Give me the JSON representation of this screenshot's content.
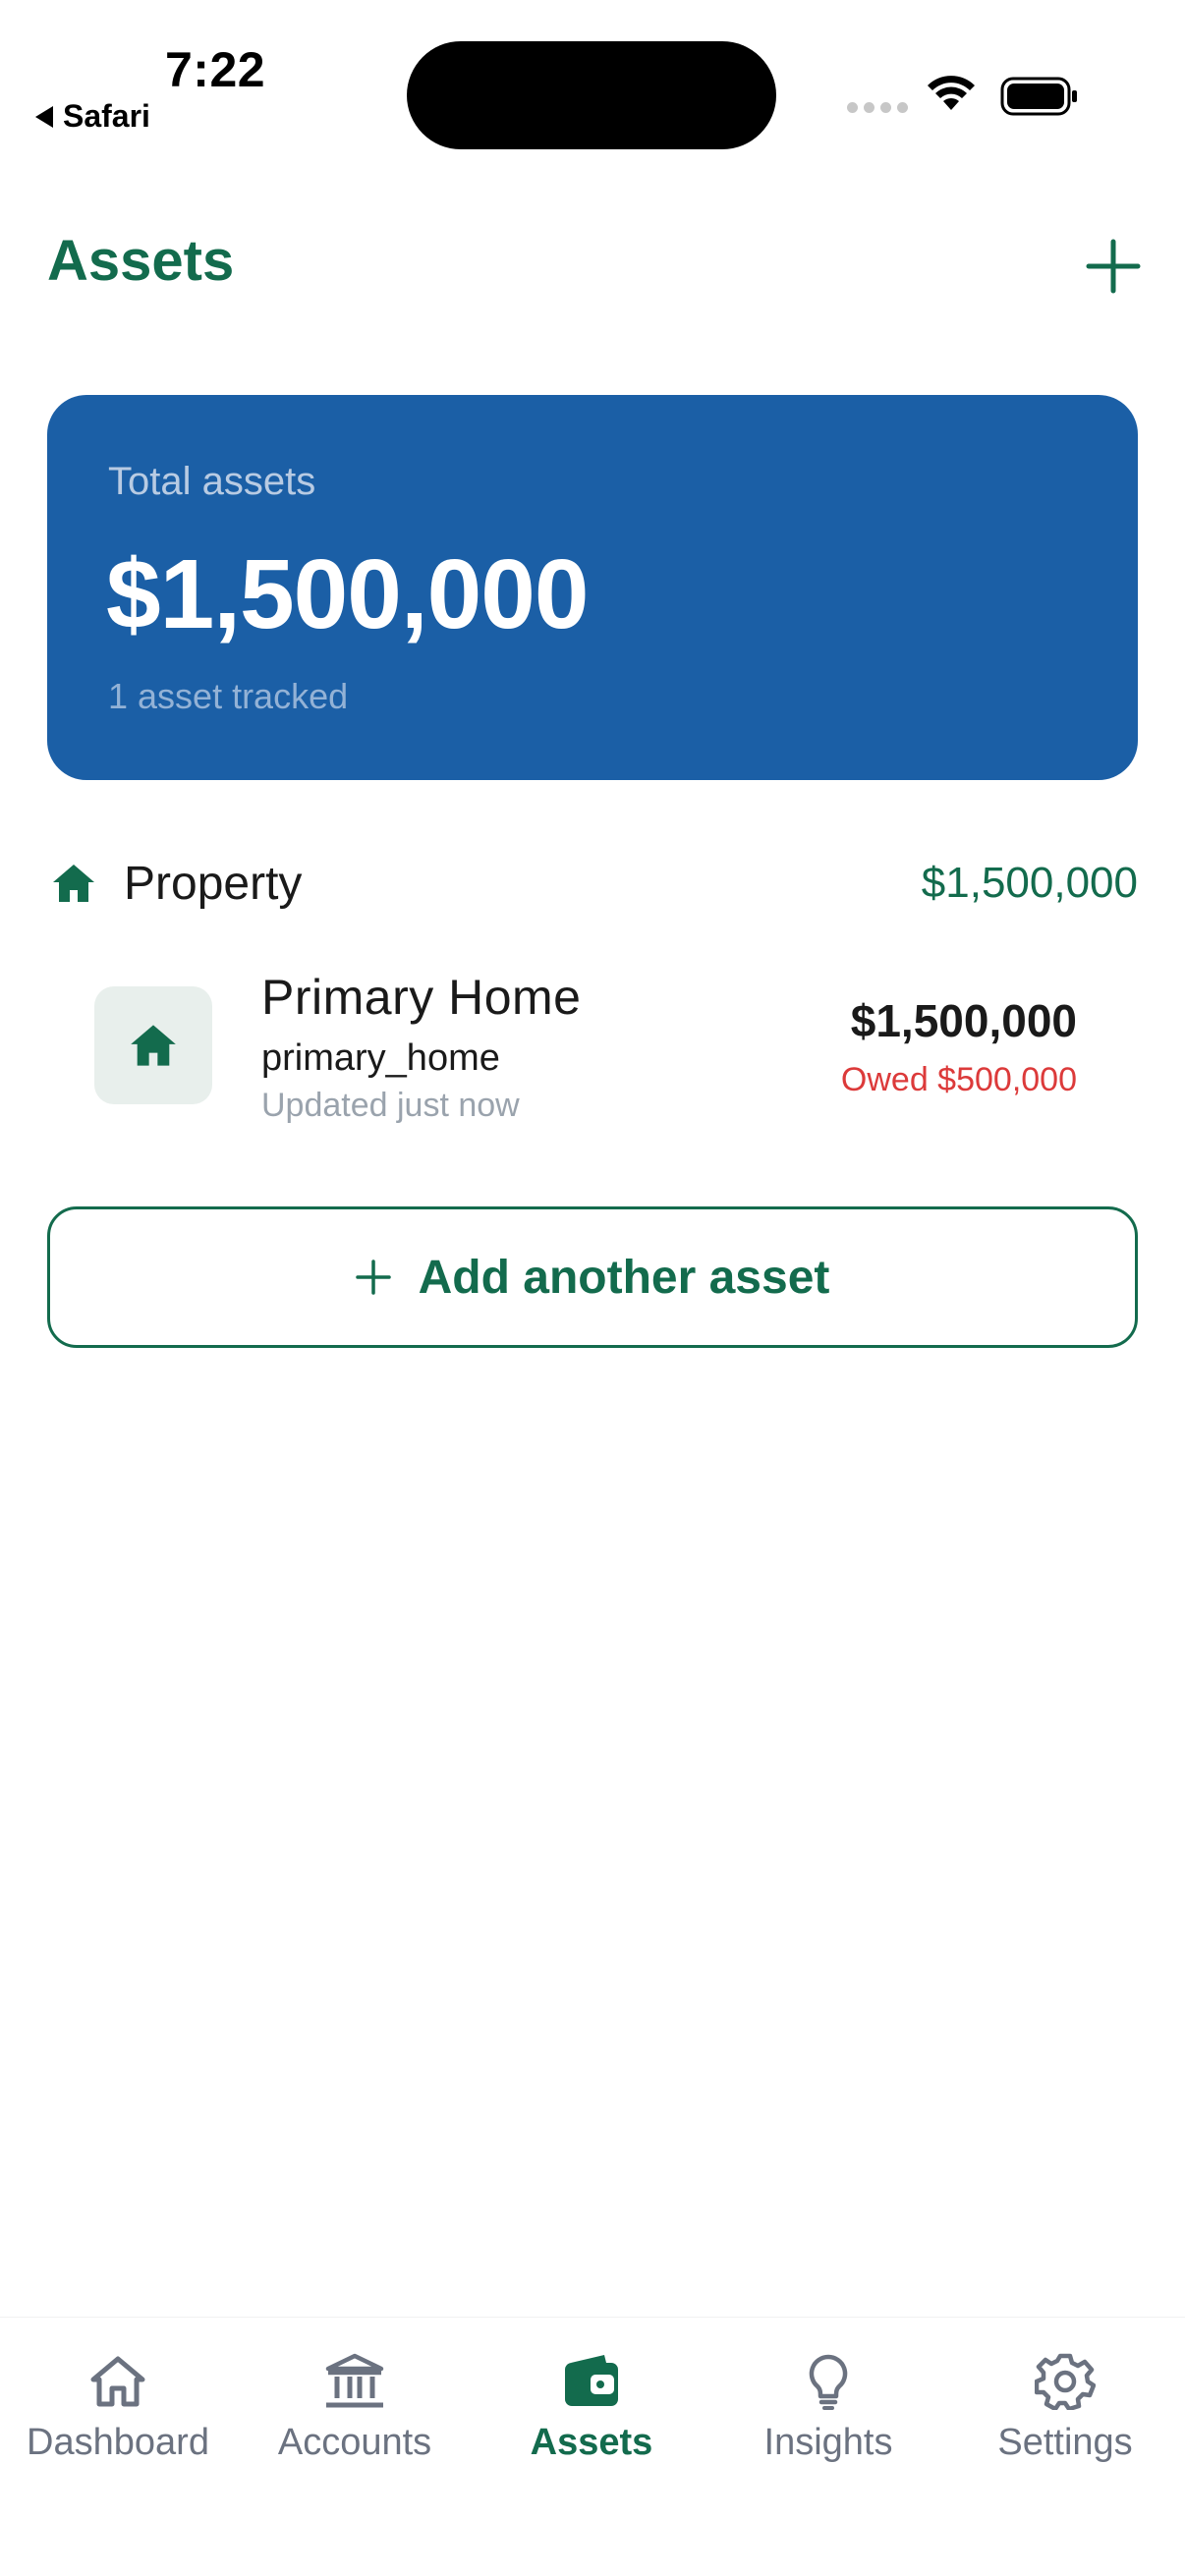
{
  "status_bar": {
    "time": "7:22",
    "back_label": "Safari"
  },
  "header": {
    "title": "Assets",
    "add_icon": "plus-icon"
  },
  "summary": {
    "label": "Total assets",
    "value": "$1,500,000",
    "subtext": "1 asset tracked",
    "color": "#1b5fa6"
  },
  "sections": [
    {
      "title": "Property",
      "icon": "home-icon",
      "total": "$1,500,000",
      "assets": [
        {
          "name": "Primary Home",
          "type": "primary_home",
          "updated": "Updated just now",
          "value": "$1,500,000",
          "owed": "Owed $500,000",
          "icon": "home-icon"
        }
      ]
    }
  ],
  "add_another": {
    "label": "Add another asset",
    "icon": "plus-icon"
  },
  "nav": {
    "items": [
      {
        "label": "Dashboard",
        "icon": "home-icon"
      },
      {
        "label": "Accounts",
        "icon": "bank-icon"
      },
      {
        "label": "Assets",
        "icon": "wallet-icon",
        "active": true
      },
      {
        "label": "Insights",
        "icon": "lightbulb-icon"
      },
      {
        "label": "Settings",
        "icon": "gear-icon"
      }
    ]
  },
  "colors": {
    "brand": "#136b4d",
    "owed": "#dc3a3a",
    "muted": "#6b7280"
  }
}
